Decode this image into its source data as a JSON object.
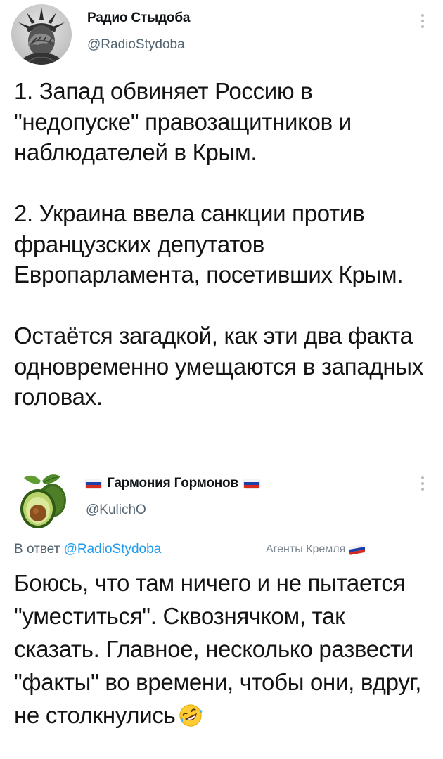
{
  "tweet": {
    "display_name": "Радио Стыдоба",
    "handle": "@RadioStydoba",
    "paragraphs": [
      "1. Запад обвиняет Россию в \"недопуске\" правозащитников и наблюдателей в Крым.",
      "2. Украина ввела санкции против французских депутатов Европарламента, посетивших Крым.",
      "Остаётся загадкой, как эти два факта одновременно умещаются в западных головах."
    ]
  },
  "reply": {
    "display_name": "Гармония Гормонов",
    "handle": "@KulichO",
    "reply_prefix": "В ответ",
    "reply_to": "@RadioStydoba",
    "label": "Агенты Кремля",
    "text": "Боюсь, что там ничего и не пытается \"уместиться\". Сквознячком, так сказать. Главное, несколько развести \"факты\" во времени, чтобы они, вдруг, не столкнулись",
    "emoji": "rolling-on-floor-laughing"
  },
  "colors": {
    "text": "#141414",
    "secondary": "#536471",
    "link": "#1d9bf0",
    "flag_white": "#f4f4f4",
    "flag_blue": "#1c3faa",
    "flag_red": "#d52b1e"
  },
  "icons": {
    "more": "more-vertical-icon",
    "avatar_main": "statue-of-liberty-facepalm",
    "avatar_reply": "avocado"
  }
}
